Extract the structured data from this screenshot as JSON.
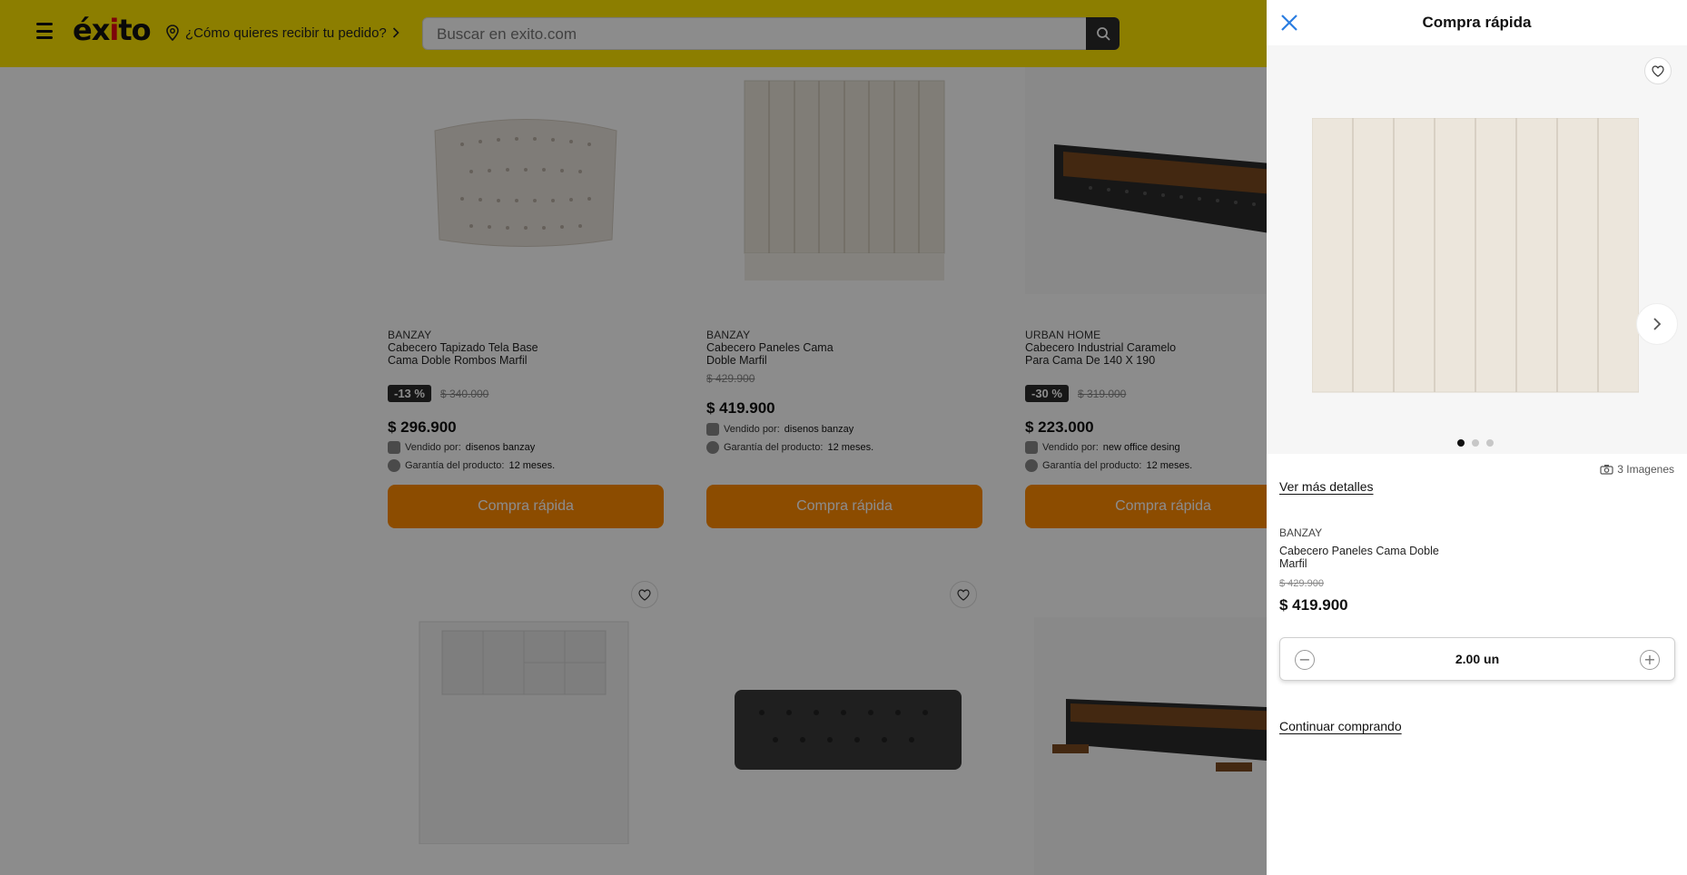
{
  "colors": {
    "header_bg": "#FFE600",
    "cta": "#FF8A00",
    "discount_bg": "#2A2A2A"
  },
  "header": {
    "logo": "éxito",
    "delivery_prompt": "¿Cómo quieres recibir tu pedido?",
    "search_placeholder": "Buscar en exito.com"
  },
  "products": [
    {
      "brand": "BANZAY",
      "title": "Cabecero Tapizado Tela Base Cama Doble Rombos Marfil",
      "discount": "-13 %",
      "old_price": "$ 340.000",
      "price": "$ 296.900",
      "seller_label": "Vendido por:",
      "seller": "disenos banzay",
      "warranty_label": "Garantía del producto:",
      "warranty": "12 meses.",
      "cta": "Compra rápida"
    },
    {
      "brand": "BANZAY",
      "title": "Cabecero Paneles Cama Doble Marfil",
      "discount": "",
      "old_price": "$ 429.900",
      "price": "$ 419.900",
      "seller_label": "Vendido por:",
      "seller": "disenos banzay",
      "warranty_label": "Garantía del producto:",
      "warranty": "12 meses.",
      "cta": "Compra rápida"
    },
    {
      "brand": "URBAN HOME",
      "title": "Cabecero Industrial Caramelo Para Cama De 140 X 190",
      "discount": "-30 %",
      "old_price": "$ 319.000",
      "price": "$ 223.000",
      "seller_label": "Vendido por:",
      "seller": "new office desing",
      "warranty_label": "Garantía del producto:",
      "warranty": "12 meses.",
      "cta": "Compra rápida"
    }
  ],
  "drawer": {
    "title": "Compra rápida",
    "image_count": "3 Imagenes",
    "more_details": "Ver más detalles",
    "brand": "BANZAY",
    "product_title": "Cabecero Paneles Cama Doble Marfil",
    "old_price": "$ 429.900",
    "price": "$ 419.900",
    "quantity": "2.00 un",
    "continue": "Continuar comprando",
    "gallery_active_index": 0,
    "gallery_total": 3
  }
}
